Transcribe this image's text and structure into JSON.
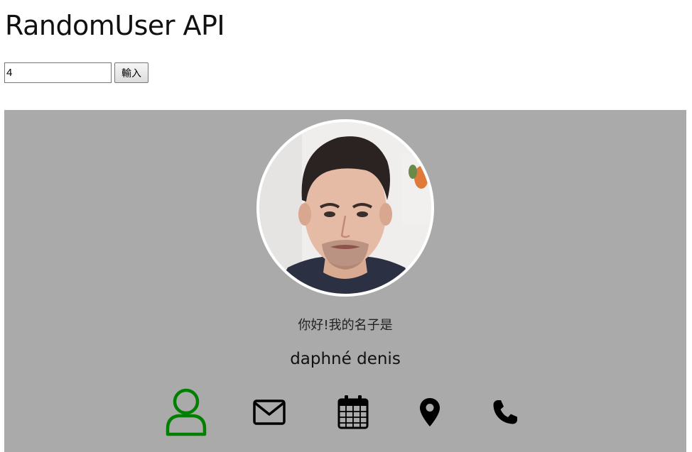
{
  "page": {
    "title": "RandomUser API"
  },
  "form": {
    "count_value": "4",
    "submit_label": "輸入"
  },
  "user": {
    "greeting": "你好!我的名子是",
    "name": "daphné denis",
    "avatar_icon": "user-portrait"
  },
  "info_icons": [
    {
      "icon": "user-icon",
      "active": true,
      "color": "#008000"
    },
    {
      "icon": "envelope-icon",
      "active": false,
      "color": "#000000"
    },
    {
      "icon": "calendar-icon",
      "active": false,
      "color": "#000000"
    },
    {
      "icon": "map-marker-icon",
      "active": false,
      "color": "#000000"
    },
    {
      "icon": "phone-icon",
      "active": false,
      "color": "#000000"
    }
  ],
  "colors": {
    "card_background": "#aaaaaa",
    "active_icon": "#008000"
  }
}
